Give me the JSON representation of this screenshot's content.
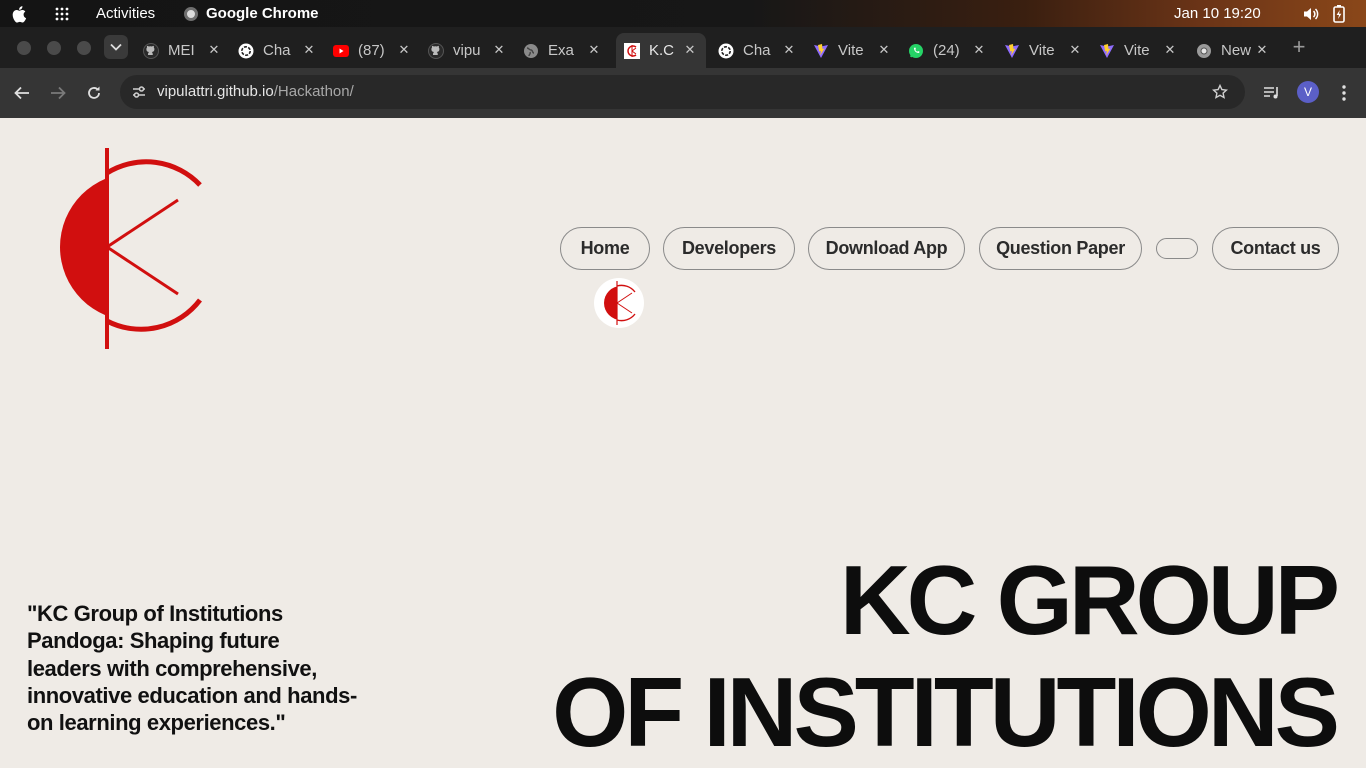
{
  "system_bar": {
    "activities": "Activities",
    "app_name": "Google Chrome",
    "clock": "Jan 10  19:20"
  },
  "tabs": [
    {
      "title": "MEI",
      "icon": "github-icon",
      "active": false
    },
    {
      "title": "Cha",
      "icon": "openai-icon",
      "active": false
    },
    {
      "title": "(87)",
      "icon": "youtube-icon",
      "active": false
    },
    {
      "title": "vipu",
      "icon": "github-icon",
      "active": false
    },
    {
      "title": "Exa",
      "icon": "globe-icon",
      "active": false
    },
    {
      "title": "K.C",
      "icon": "kc-logo-icon",
      "active": true
    },
    {
      "title": "Cha",
      "icon": "openai-icon",
      "active": false
    },
    {
      "title": "Vite",
      "icon": "vite-icon",
      "active": false
    },
    {
      "title": "(24)",
      "icon": "whatsapp-icon",
      "active": false
    },
    {
      "title": "Vite",
      "icon": "vite-icon",
      "active": false
    },
    {
      "title": "Vite",
      "icon": "vite-icon",
      "active": false
    },
    {
      "title": "New",
      "icon": "chrome-icon",
      "active": false
    }
  ],
  "toolbar": {
    "url_host": "vipulattri.github.io",
    "url_path": "/Hackathon/",
    "profile_initial": "V"
  },
  "nav": {
    "home": "Home",
    "developers": "Developers",
    "download_app": "Download App",
    "question_paper": "Question Paper",
    "empty": "",
    "contact_us": "Contact us"
  },
  "hero": {
    "tagline": "\"KC Group of Institutions Pandoga: Shaping future leaders with comprehensive, innovative education and hands-on learning experiences.\"",
    "line1": "KC GROUP",
    "line2": "OF INSTITUTIONS"
  },
  "colors": {
    "page_bg": "#efebe6",
    "logo_red": "#d10f0f",
    "chrome_tab_bg": "#1f1f1f",
    "chrome_toolbar_bg": "#353535"
  }
}
